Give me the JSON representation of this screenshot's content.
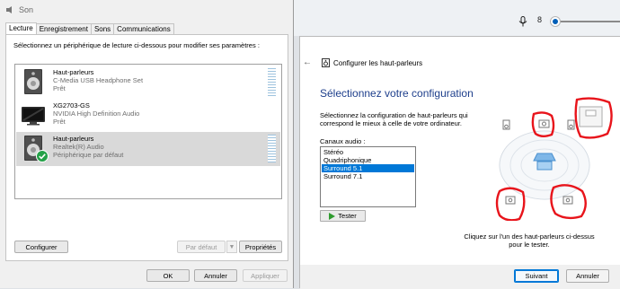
{
  "taskbar": {
    "volume_value": "8",
    "volume_fraction": 0.08
  },
  "sound_dialog": {
    "title": "Son",
    "tabs": [
      "Lecture",
      "Enregistrement",
      "Sons",
      "Communications"
    ],
    "active_tab": 0,
    "instruction": "Sélectionnez un périphérique de lecture ci-dessous pour modifier ses paramètres :",
    "devices": [
      {
        "name": "Haut-parleurs",
        "desc": "C-Media USB Headphone Set",
        "status": "Prêt",
        "icon": "speaker-icon",
        "selected": false,
        "is_default": false
      },
      {
        "name": "XG2703-GS",
        "desc": "NVIDIA High Definition Audio",
        "status": "Prêt",
        "icon": "monitor-icon",
        "selected": false,
        "is_default": false
      },
      {
        "name": "Haut-parleurs",
        "desc": "Realtek(R) Audio",
        "status": "Périphérique par défaut",
        "icon": "speaker-icon",
        "selected": true,
        "is_default": true
      }
    ],
    "configure_button": "Configurer",
    "default_button": "Par défaut",
    "properties_button": "Propriétés",
    "ok_button": "OK",
    "cancel_button": "Annuler",
    "apply_button": "Appliquer"
  },
  "speaker_config": {
    "window_title": "Configurer les haut-parleurs",
    "heading": "Sélectionnez votre configuration",
    "description": "Sélectionnez la configuration de haut-parleurs qui correspond le mieux à celle de votre ordinateur.",
    "channels_label": "Canaux audio :",
    "channels": [
      "Stéréo",
      "Quadriphonique",
      "Surround 5.1",
      "Surround 7.1"
    ],
    "selected_channel": "Surround 5.1",
    "test_button": "Tester",
    "hint": "Cliquez sur l'un des haut-parleurs ci-dessus pour le tester.",
    "next_button": "Suivant",
    "cancel_button": "Annuler",
    "annotation_color": "#e8141b",
    "accent_color": "#0078d7"
  }
}
